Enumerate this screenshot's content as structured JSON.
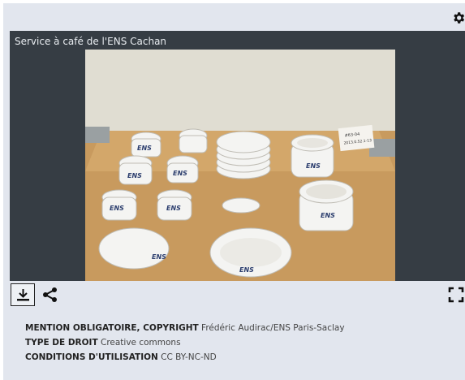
{
  "viewer": {
    "title": "Service à café de l'ENS Cachan",
    "image_alt": "Service à café ENS : tasses, soucoupes, sucriers et pots en porcelaine blanche"
  },
  "icons": {
    "settings": "gear-icon",
    "download": "download-icon",
    "share": "share-icon",
    "fullscreen": "fullscreen-icon"
  },
  "metadata": [
    {
      "label": "MENTION OBLIGATOIRE, COPYRIGHT",
      "value": "Frédéric Audirac/ENS Paris-Saclay"
    },
    {
      "label": "TYPE DE DROIT",
      "value": "Creative commons"
    },
    {
      "label": "CONDITIONS D'UTILISATION",
      "value": "CC BY-NC-ND"
    }
  ],
  "colors": {
    "panel_bg": "#e2e6ee",
    "viewer_bg": "#363d44",
    "text": "#333333"
  }
}
